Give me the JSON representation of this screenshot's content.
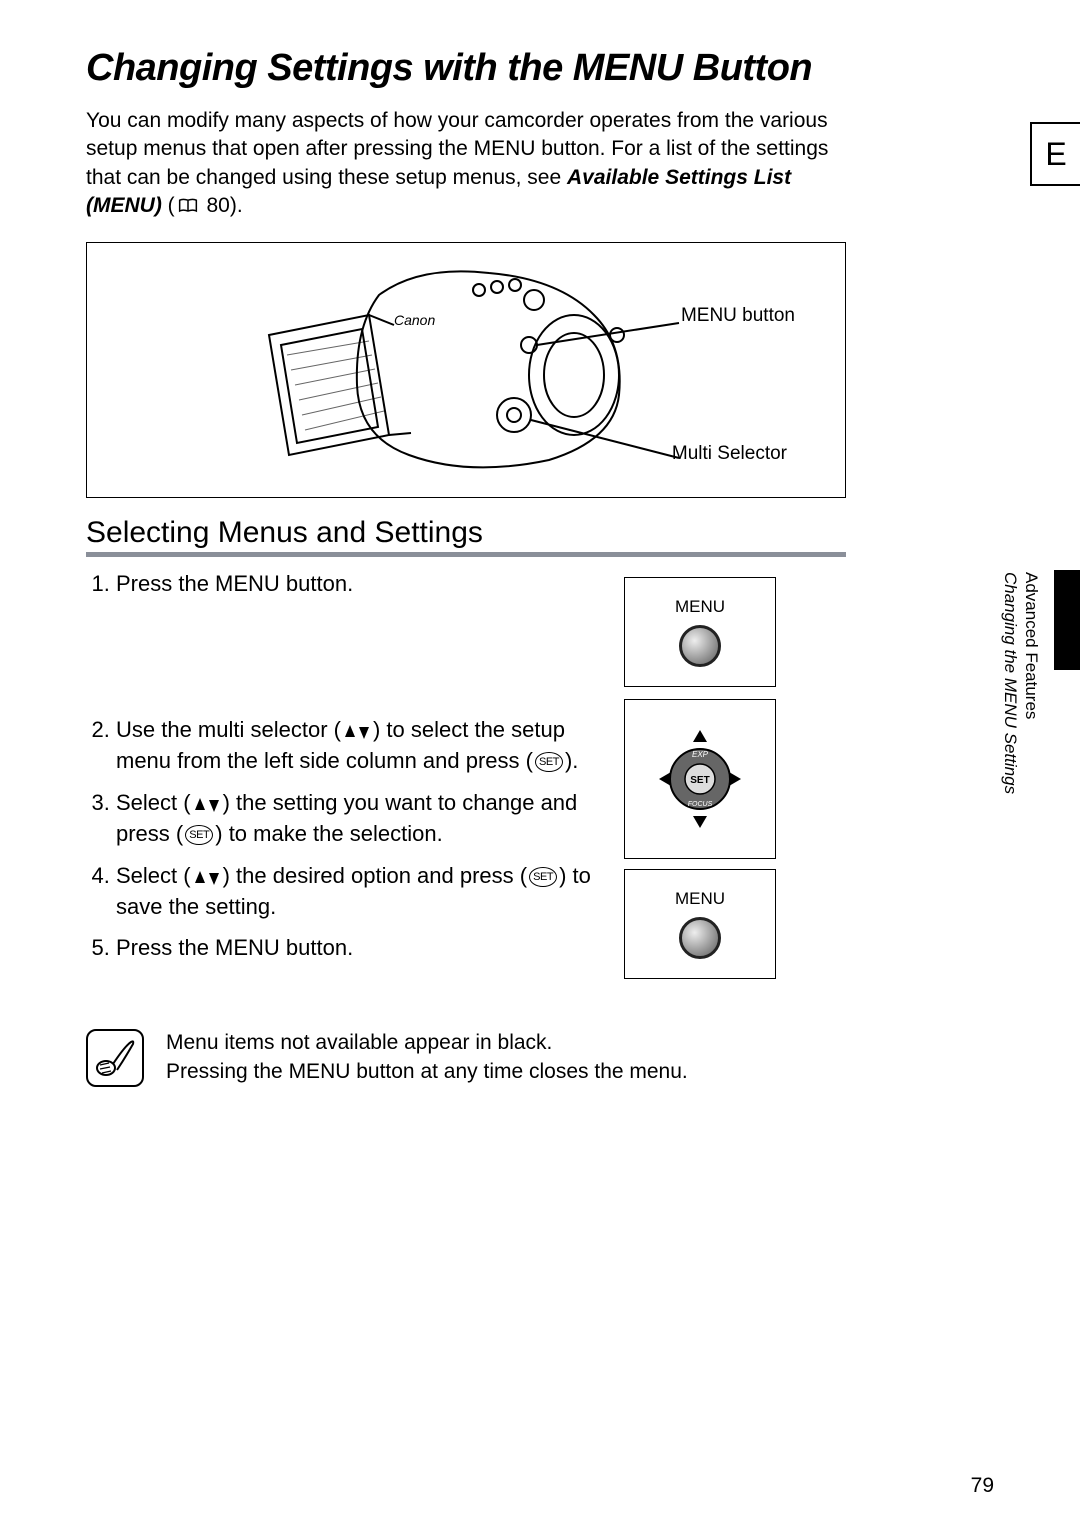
{
  "lang_tab": "E",
  "title": "Changing Settings with the MENU Button",
  "intro_pre": "You can modify many aspects of how your camcorder operates from the various setup menus that open after pressing the MENU button. For a list of the settings that can be changed using these setup menus, see ",
  "intro_em": "Available Settings List (MENU)",
  "intro_post": " 80).",
  "figure": {
    "menu_label": "MENU button",
    "multi_label": "Multi Selector"
  },
  "subhead": "Selecting Menus and Settings",
  "steps": {
    "s1": "Press the MENU button.",
    "s2a": "Use the multi selector (",
    "s2b": ") to select the setup menu from the left side column and press (",
    "s2c": ").",
    "s3a": "Select (",
    "s3b": ") the setting you want to change and press (",
    "s3c": ") to make the selection.",
    "s4a": "Select (",
    "s4b": ") the desired option and press (",
    "s4c": ") to save the setting.",
    "s5": "Press the MENU button."
  },
  "icon_boxes": {
    "menu_label": "MENU",
    "selector_set": "SET",
    "selector_exp": "EXP",
    "selector_focus": "FOCUS"
  },
  "sidebar": {
    "line1": "Advanced Features",
    "line2": "Changing the MENU Settings"
  },
  "notes": {
    "n1": "Menu items not available appear in black.",
    "n2": "Pressing the MENU button at any time closes the menu."
  },
  "set_label": "SET",
  "page_number": "79"
}
